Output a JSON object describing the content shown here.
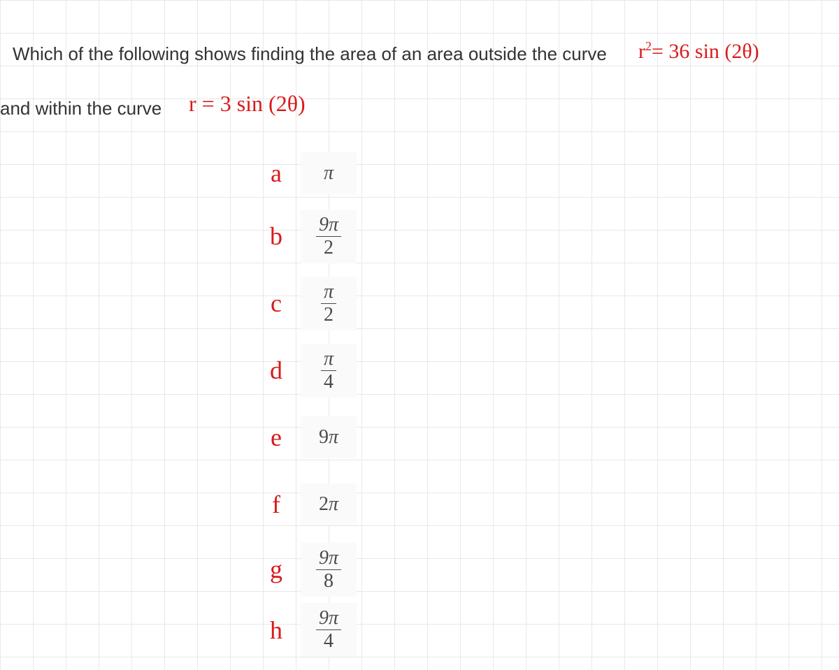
{
  "question": {
    "line1": "Which of the following shows finding the area of an area outside the curve",
    "line2": "and within the curve",
    "formula1_html": "r<sup>2</sup>= 36 sin (2θ)",
    "formula2": "r = 3 sin (2θ)"
  },
  "options": [
    {
      "label": "a",
      "value_html": "<span class='pi-sym'>π</span>"
    },
    {
      "label": "b",
      "value_html": "<span class='fraction'><span class='num'>9<span class=\"pi-sym\">π</span></span><span class='den'>2</span></span>"
    },
    {
      "label": "c",
      "value_html": "<span class='fraction'><span class='num'><span class=\"pi-sym\">π</span></span><span class='den'>2</span></span>"
    },
    {
      "label": "d",
      "value_html": "<span class='fraction'><span class='num'><span class=\"pi-sym\">π</span></span><span class='den'>4</span></span>"
    },
    {
      "label": "e",
      "value_html": "9<span class='pi-sym'>π</span>"
    },
    {
      "label": "f",
      "value_html": "2<span class='pi-sym'>π</span>"
    },
    {
      "label": "g",
      "value_html": "<span class='fraction'><span class='num'>9<span class=\"pi-sym\">π</span></span><span class='den'>8</span></span>"
    },
    {
      "label": "h",
      "value_html": "<span class='fraction'><span class='num'>9<span class=\"pi-sym\">π</span></span><span class='den'>4</span></span>"
    }
  ]
}
